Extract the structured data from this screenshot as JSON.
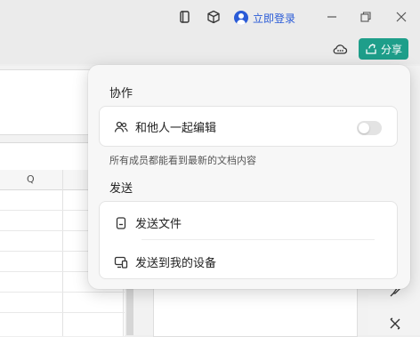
{
  "titlebar": {
    "login_label": "立即登录"
  },
  "share": {
    "label": "分享",
    "color": "#1e9e8a"
  },
  "sheet": {
    "column_header": "Q"
  },
  "popup": {
    "collab_title": "协作",
    "collab_item": "和他人一起编辑",
    "collab_toggle_on": false,
    "collab_desc": "所有成员都能看到最新的文档内容",
    "send_title": "发送",
    "send_items": [
      {
        "label": "发送文件",
        "icon": "file-icon"
      },
      {
        "label": "发送到我的设备",
        "icon": "device-icon"
      }
    ]
  },
  "colors": {
    "accent": "#2a5bd7",
    "toggle_off": "#e3e3e3"
  }
}
